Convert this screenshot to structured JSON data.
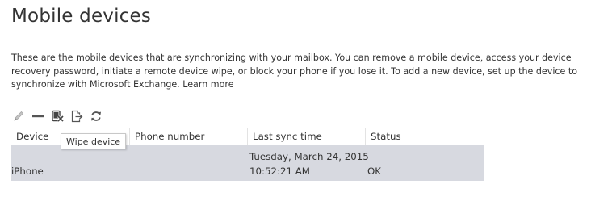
{
  "page": {
    "title": "Mobile devices",
    "description": "These are the mobile devices that are synchronizing with your mailbox. You can remove a mobile device, access your device recovery password, initiate a remote device wipe, or block your phone if you lose it. To add a new device, set up the device to synchronize with Microsoft Exchange.",
    "learn_more": "Learn more"
  },
  "toolbar": {
    "icons": [
      "pencil-icon",
      "minus-icon",
      "wipe-device-icon",
      "export-icon",
      "refresh-icon"
    ],
    "tooltip": "Wipe device"
  },
  "table": {
    "columns": [
      "Device",
      "Phone number",
      "Last sync time",
      "Status"
    ],
    "rows": [
      {
        "device": "iPhone",
        "phone_number": "",
        "last_sync_date": "Tuesday, March 24, 2015",
        "last_sync_time": "10:52:21 AM",
        "status": "OK"
      }
    ]
  },
  "colors": {
    "text": "#333333",
    "selected_row": "#d7d9e0",
    "border": "#e3e3e3",
    "icon": "#555555"
  }
}
